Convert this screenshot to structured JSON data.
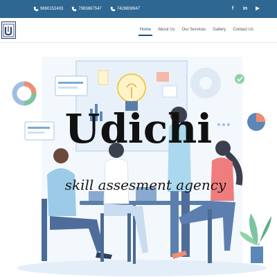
{
  "topbar": {
    "phones": [
      "9690152403",
      "7983667547",
      "7428808947"
    ],
    "social_icons": [
      {
        "name": "facebook-icon",
        "glyph": "f"
      },
      {
        "name": "linkedin-icon",
        "glyph": "in"
      },
      {
        "name": "youtube-icon",
        "glyph": "▶"
      }
    ]
  },
  "logo": {
    "glyph": "U"
  },
  "nav": {
    "items": [
      {
        "label": "Home",
        "active": true
      },
      {
        "label": "About Us",
        "active": false
      },
      {
        "label": "Our Services",
        "active": false
      },
      {
        "label": "Gallery",
        "active": false
      },
      {
        "label": "Contact Us",
        "active": false
      }
    ]
  },
  "hero": {
    "title": "Udichi",
    "subtitle": "skill assesment agency"
  },
  "colors": {
    "topbar": "#2e6792",
    "accent": "#1f4f78",
    "illustration_blue": "#dbe9f6"
  }
}
